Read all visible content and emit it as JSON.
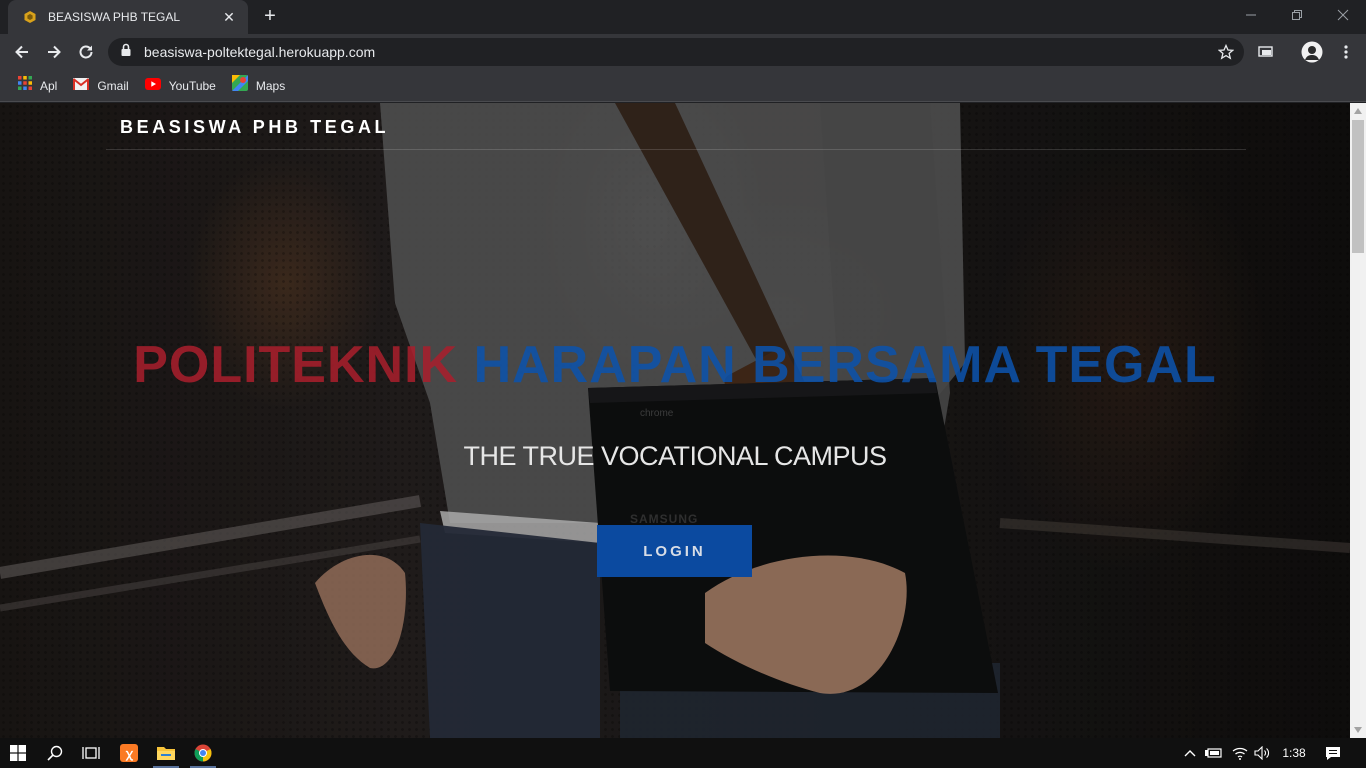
{
  "browser": {
    "tab": {
      "title": "BEASISWA PHB TEGAL",
      "favicon": "hexagon-favicon",
      "close_icon": "close-icon"
    },
    "newtab_icon": "plus-icon",
    "window_controls": [
      "minimize-icon",
      "restore-icon",
      "close-icon"
    ],
    "url": "beasiswa-poltektegal.herokuapp.com",
    "bookmarks": [
      {
        "label": "Apl",
        "icon": "apps-grid-icon"
      },
      {
        "label": "Gmail",
        "icon": "gmail-icon"
      },
      {
        "label": "YouTube",
        "icon": "youtube-icon"
      },
      {
        "label": "Maps",
        "icon": "maps-icon"
      }
    ]
  },
  "page": {
    "brand": "BEASISWA PHB TEGAL",
    "headline_part1": "POLITEKNIK",
    "headline_part2": "HARAPAN BERSAMA TEGAL",
    "tagline": "THE TRUE VOCATIONAL CAMPUS",
    "login_label": "LOGIN",
    "colors": {
      "headline_red": "#aa1f2d",
      "headline_blue": "#0d52aa",
      "login_bg": "#0b4aa0"
    }
  },
  "taskbar": {
    "time": "1:38",
    "apps": [
      "windows-start-icon",
      "search-icon",
      "task-view-icon",
      "xampp-icon",
      "file-explorer-icon",
      "chrome-icon"
    ],
    "tray": [
      "chevron-up-icon",
      "battery-icon",
      "wifi-icon",
      "volume-icon",
      "notification-icon"
    ]
  }
}
